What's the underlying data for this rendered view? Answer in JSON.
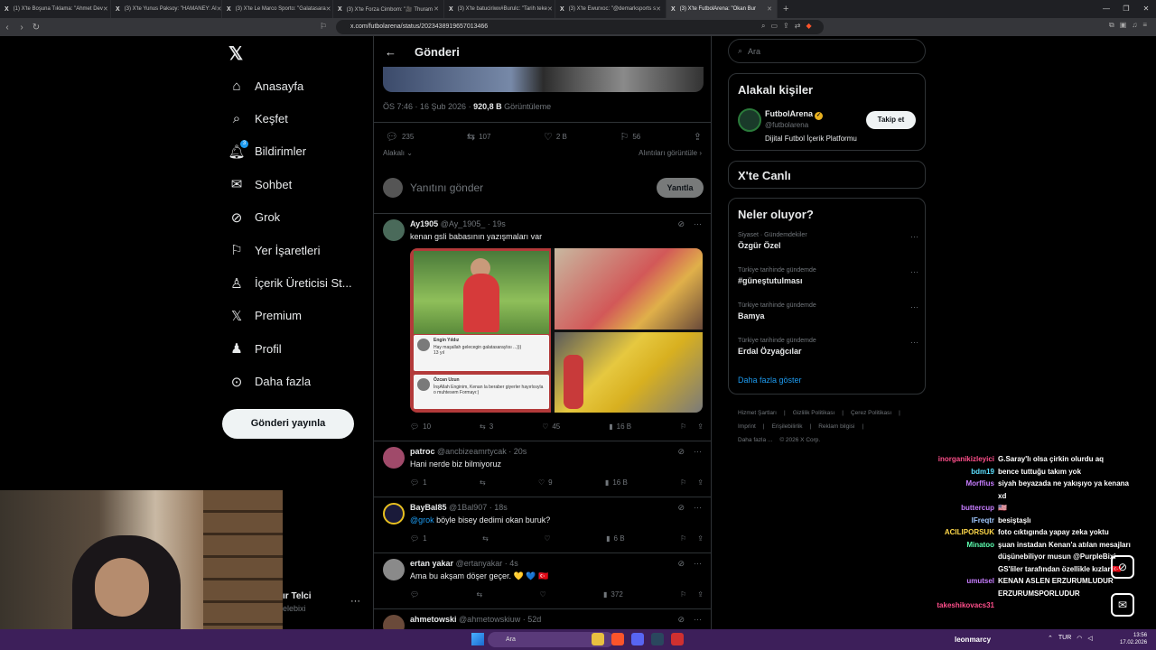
{
  "browser": {
    "tabs": [
      {
        "label": "(1) X'te Boşuna Tıklama: \"Ahmet Dev",
        "active": false
      },
      {
        "label": "(3) X'te Yunus Paksoy: \"HAMANEY: Al",
        "active": false
      },
      {
        "label": "(3) X'te Le Marco Sporto: \"Galatasara",
        "active": false
      },
      {
        "label": "(3) X'te Forza Cimbom: \"🎥 Thuram",
        "active": false
      },
      {
        "label": "(3) X'te batuciriwx#Burulc: \"Tarih teke",
        "active": false
      },
      {
        "label": "(3) X'te Ewurxoc: \"@demarksports s",
        "active": false
      },
      {
        "label": "(3) X'te FutbolArena: \"Okan Bur",
        "active": true
      }
    ],
    "url": "x.com/futbolarena/status/2023438919657013466"
  },
  "sidebar": {
    "items": [
      {
        "label": "Anasayfa",
        "icon": "home-icon",
        "glyph": "⌂"
      },
      {
        "label": "Keşfet",
        "icon": "search-icon",
        "glyph": "⌕"
      },
      {
        "label": "Bildirimler",
        "icon": "bell-icon",
        "glyph": "🔔︎",
        "badge": "3"
      },
      {
        "label": "Sohbet",
        "icon": "mail-icon",
        "glyph": "✉"
      },
      {
        "label": "Grok",
        "icon": "grok-icon",
        "glyph": "⊘"
      },
      {
        "label": "Yer İşaretleri",
        "icon": "bookmark-icon",
        "glyph": "⚐"
      },
      {
        "label": "İçerik Üreticisi St...",
        "icon": "creator-icon",
        "glyph": "♙"
      },
      {
        "label": "Premium",
        "icon": "x-premium-icon",
        "glyph": "𝕏"
      },
      {
        "label": "Profil",
        "icon": "profile-icon",
        "glyph": "♟"
      },
      {
        "label": "Daha fazla",
        "icon": "more-icon",
        "glyph": "⊙"
      }
    ],
    "post_button": "Gönderi yayınla",
    "account": {
      "name": "ır Telci",
      "handle": "elebixi"
    }
  },
  "main": {
    "header_title": "Gönderi",
    "meta_time": "ÖS 7:46 · 16 Şub 2026 · ",
    "meta_views": "920,8 B",
    "meta_views_label": " Görüntüleme",
    "stats": {
      "replies": "235",
      "reposts": "107",
      "likes": "2 B",
      "bookmarks": "56"
    },
    "relevant_label": "Alakalı",
    "quotes_label": "Alıntıları görüntüle",
    "reply_placeholder": "Yanıtını gönder",
    "reply_button": "Yanıtla",
    "tweets": [
      {
        "name": "Ay1905",
        "handle": "@Ay_1905_",
        "time": "· 19s",
        "text": "kenan gsli babasının yazışmaları var",
        "replies": "10",
        "reposts": "3",
        "likes": "45",
        "views": "16 B",
        "comments": [
          {
            "author": "Engin Yıldız",
            "text": "Hay maşallah gelecegin galatasaraylısı ...)))",
            "time": "13 yıl"
          },
          {
            "author": "Özcan Uzun",
            "text": "İnşAllah Enginim, Kenan la beraber giyerler hayırlısıyla o muhtesem Formayı:)"
          }
        ]
      },
      {
        "name": "patroc",
        "handle": "@ancbizeamrtycak",
        "time": "· 20s",
        "text": "Hani nerde biz bilmiyoruz",
        "replies": "1",
        "reposts": "",
        "likes": "9",
        "views": "16 B"
      },
      {
        "name": "BayBal85",
        "handle": "@1Bal907",
        "time": "· 18s",
        "mention": "@grok",
        "text": " böyle bisey dedimi okan buruk?",
        "replies": "1",
        "reposts": "",
        "likes": "",
        "views": "6 B"
      },
      {
        "name": "ertan yakar",
        "handle": "@ertanyakar",
        "time": "· 4s",
        "text": "Ama bu akşam döşer geçer. 💛 💙 🇹🇷",
        "replies": "",
        "reposts": "",
        "likes": "",
        "views": "372"
      },
      {
        "name": "ahmetowski",
        "handle": "@ahmetowskiuw",
        "time": "· 52d",
        "text": ""
      }
    ]
  },
  "right": {
    "search_placeholder": "Ara",
    "related_title": "Alakalı kişiler",
    "related": {
      "name": "FutbolArena",
      "handle": "@futbolarena",
      "bio": "Dijital Futbol İçerik Platformu",
      "follow": "Takip et"
    },
    "live_title": "X'te Canlı",
    "trends_title": "Neler oluyor?",
    "trends": [
      {
        "context": "Siyaset · Gündemdekiler",
        "title": "Özgür Özel"
      },
      {
        "context": "Türkiye tarihinde gündemde",
        "title": "#güneştutulması"
      },
      {
        "context": "Türkiye tarihinde gündemde",
        "title": "Bamya"
      },
      {
        "context": "Türkiye tarihinde gündemde",
        "title": "Erdal Özyağcılar"
      }
    ],
    "show_more": "Daha fazla göster",
    "footer": [
      "Hizmet Şartları",
      "|",
      "Gizlilik Politikası",
      "|",
      "Çerez Politikası",
      "|",
      "Imprint",
      "|",
      "Erişilebilirlik",
      "|",
      "Reklam bilgisi",
      "|",
      "Daha fazla ...",
      "© 2026 X Corp."
    ]
  },
  "chat": [
    {
      "user": "inorganikizleyici",
      "color": "#ff4f8b",
      "msg": "G.Saray'lı olsa çirkin olurdu aq"
    },
    {
      "user": "bdm19",
      "color": "#5de0ff",
      "msg": "bence tuttuğu takım yok"
    },
    {
      "user": "Morffius",
      "color": "#c77dff",
      "msg": "siyah beyazada ne yakışıyo ya kenana xd"
    },
    {
      "user": "buttercup",
      "color": "#c77dff",
      "msg": "🇺🇸"
    },
    {
      "user": "lFreqtr",
      "color": "#a0c8ff",
      "msg": "besiştaşlı"
    },
    {
      "user": "ACILIPORSUK",
      "color": "#ffd84a",
      "msg": "foto cıktıgında yapay zeka yoktu"
    },
    {
      "user": "Minatoo",
      "color": "#5dffb0",
      "msg": "şuan instadan Kenan'a atılan mesajları düşünebiliyor musun @PurpleBixi GS'liler tarafından özellikle kızlar 🇹🇷"
    },
    {
      "user": "umutsel",
      "color": "#c77dff",
      "msg": "KENAN ASLEN ERZURUMLUDUR ERZURUMSPORLUDUR"
    },
    {
      "user": "takeshikovacs31",
      "color": "#ff4f8b",
      "msg": ""
    }
  ],
  "taskbar": {
    "search": "Ara",
    "user": "leonmarcy",
    "lang": "TUR",
    "time": "13:56",
    "date": "17.02.2026"
  }
}
